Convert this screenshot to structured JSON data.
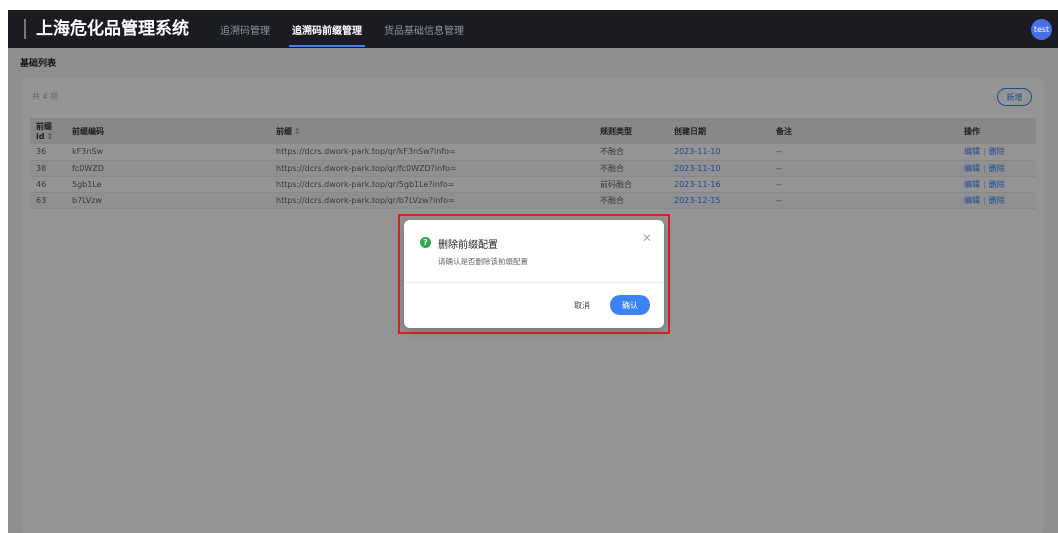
{
  "app": {
    "title": "上海危化品管理系统",
    "user_avatar": "test"
  },
  "nav": {
    "tabs": [
      "追溯码管理",
      "追溯码前缀管理",
      "货品基础信息管理"
    ],
    "active_tab": "追溯码前缀管理"
  },
  "page": {
    "title": "基础列表",
    "total": "共 4 项",
    "add_button": "新增"
  },
  "table": {
    "headers": {
      "id": "前缀id",
      "code": "前缀编码",
      "prefix": "前缀",
      "rule_type": "规则类型",
      "created": "创建日期",
      "remark": "备注",
      "actions": "操作"
    },
    "rows": [
      {
        "id": "36",
        "code": "kF3nSw",
        "prefix": "https://dcrs.dwork-park.top/qr/kF3nSw?info=",
        "rule_type": "不融合",
        "created": "2023-11-10",
        "remark": "--"
      },
      {
        "id": "38",
        "code": "fc0WZD",
        "prefix": "https://dcrs.dwork-park.top/qr/fc0WZD?info=",
        "rule_type": "不融合",
        "created": "2023-11-10",
        "remark": "--"
      },
      {
        "id": "46",
        "code": "5gb1Le",
        "prefix": "https://dcrs.dwork-park.top/qr/5gb1Le?info=",
        "rule_type": "前码融合",
        "created": "2023-11-16",
        "remark": "--"
      },
      {
        "id": "63",
        "code": "b7LVzw",
        "prefix": "https://dcrs.dwork-park.top/qr/b7LVzw?info=",
        "rule_type": "不融合",
        "created": "2023-12-15",
        "remark": "--"
      }
    ],
    "edit_label": "编辑",
    "delete_label": "删除"
  },
  "dialog": {
    "title": "删除前缀配置",
    "message": "请确认是否删除该前缀配置",
    "cancel": "取消",
    "confirm": "确认"
  },
  "colors": {
    "accent": "#3a82f6",
    "success_icon": "#2eaa4f",
    "highlight_border": "#e02020",
    "topbar": "#1a1c21"
  }
}
